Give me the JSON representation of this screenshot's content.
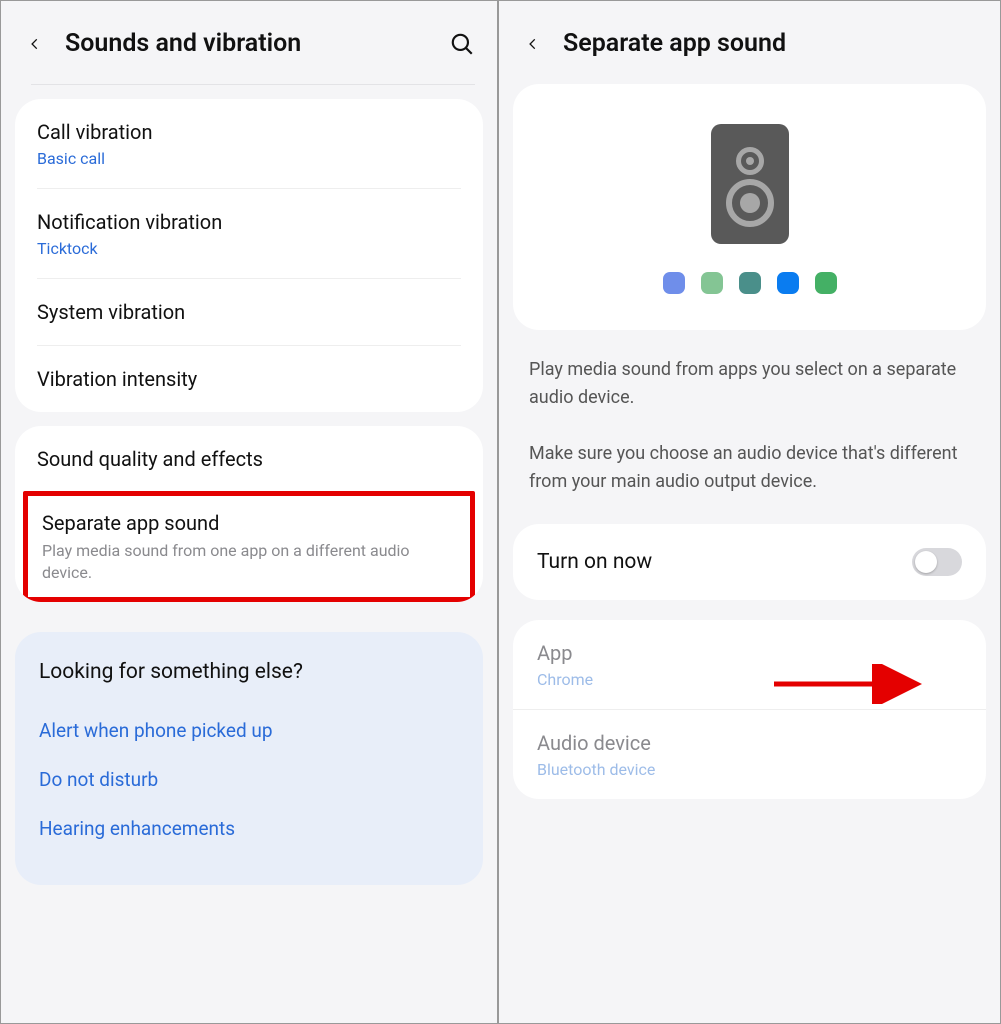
{
  "left": {
    "title": "Sounds and vibration",
    "rows": {
      "call_vibration": {
        "title": "Call vibration",
        "sub": "Basic call"
      },
      "notification_vibration": {
        "title": "Notification vibration",
        "sub": "Ticktock"
      },
      "system_vibration": {
        "title": "System vibration"
      },
      "vibration_intensity": {
        "title": "Vibration intensity"
      },
      "sound_quality": {
        "title": "Sound quality and effects"
      },
      "separate_app_sound": {
        "title": "Separate app sound",
        "sub": "Play media sound from one app on a different audio device."
      }
    },
    "suggest": {
      "heading": "Looking for something else?",
      "links": [
        "Alert when phone picked up",
        "Do not disturb",
        "Hearing enhancements"
      ]
    }
  },
  "right": {
    "title": "Separate app sound",
    "dot_colors": [
      "#6f8eea",
      "#84c594",
      "#4a8f8a",
      "#0a7cf0",
      "#44b065"
    ],
    "desc1": "Play media sound from apps you select on a separate audio device.",
    "desc2": "Make sure you choose an audio device that's different from your main audio output device.",
    "toggle_label": "Turn on now",
    "toggle_on": false,
    "options": {
      "app": {
        "title": "App",
        "value": "Chrome"
      },
      "audio_device": {
        "title": "Audio device",
        "value": "Bluetooth device"
      }
    }
  }
}
